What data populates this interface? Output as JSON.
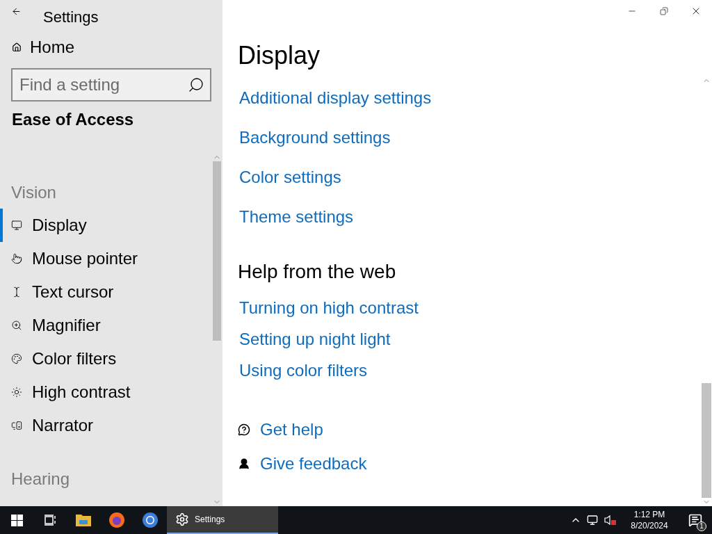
{
  "window": {
    "title": "Settings"
  },
  "sidebar": {
    "home": "Home",
    "search": {
      "placeholder": "Find a setting"
    },
    "category": "Ease of Access",
    "groups": [
      {
        "title": "Vision",
        "items": [
          {
            "label": "Display",
            "kind": "display",
            "selected": true
          },
          {
            "label": "Mouse pointer",
            "kind": "pointer",
            "selected": false
          },
          {
            "label": "Text cursor",
            "kind": "cursor",
            "selected": false
          },
          {
            "label": "Magnifier",
            "kind": "magnifier",
            "selected": false
          },
          {
            "label": "Color filters",
            "kind": "palette",
            "selected": false
          },
          {
            "label": "High contrast",
            "kind": "contrast",
            "selected": false
          },
          {
            "label": "Narrator",
            "kind": "narrator",
            "selected": false
          }
        ]
      },
      {
        "title": "Hearing"
      }
    ]
  },
  "main": {
    "title": "Display",
    "related_links": [
      "Additional display settings",
      "Background settings",
      "Color settings",
      "Theme settings"
    ],
    "help": {
      "title": "Help from the web",
      "links": [
        "Turning on high contrast",
        "Setting up night light",
        "Using color filters"
      ]
    },
    "actions": [
      {
        "label": "Get help",
        "kind": "help"
      },
      {
        "label": "Give feedback",
        "kind": "feedback"
      }
    ]
  },
  "taskbar": {
    "apps": [
      {
        "kind": "taskview"
      },
      {
        "kind": "explorer"
      },
      {
        "kind": "firefox"
      },
      {
        "kind": "chrome"
      },
      {
        "kind": "settings",
        "label": "Settings",
        "selected": true
      }
    ],
    "time": "1:12 PM",
    "date": "8/20/2024",
    "notifications": "1"
  }
}
